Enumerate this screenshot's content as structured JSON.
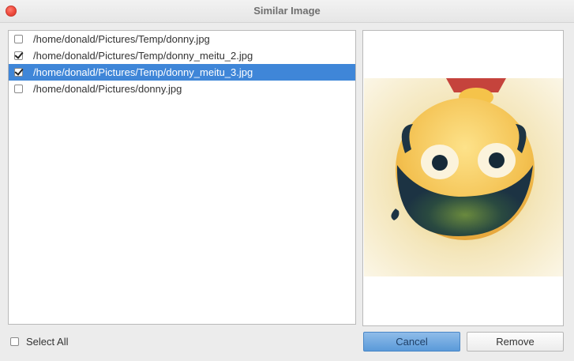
{
  "window": {
    "title": "Similar Image"
  },
  "files": [
    {
      "path": "/home/donald/Pictures/Temp/donny.jpg",
      "checked": false,
      "selected": false
    },
    {
      "path": "/home/donald/Pictures/Temp/donny_meitu_2.jpg",
      "checked": true,
      "selected": false
    },
    {
      "path": "/home/donald/Pictures/Temp/donny_meitu_3.jpg",
      "checked": true,
      "selected": true
    },
    {
      "path": "/home/donald/Pictures/donny.jpg",
      "checked": false,
      "selected": false
    }
  ],
  "select_all": {
    "label": "Select All",
    "checked": false
  },
  "buttons": {
    "cancel": "Cancel",
    "remove": "Remove"
  },
  "colors": {
    "selection": "#3f86d8",
    "close": "#ee4a3d",
    "cancel_button": "#5a9ad9"
  }
}
